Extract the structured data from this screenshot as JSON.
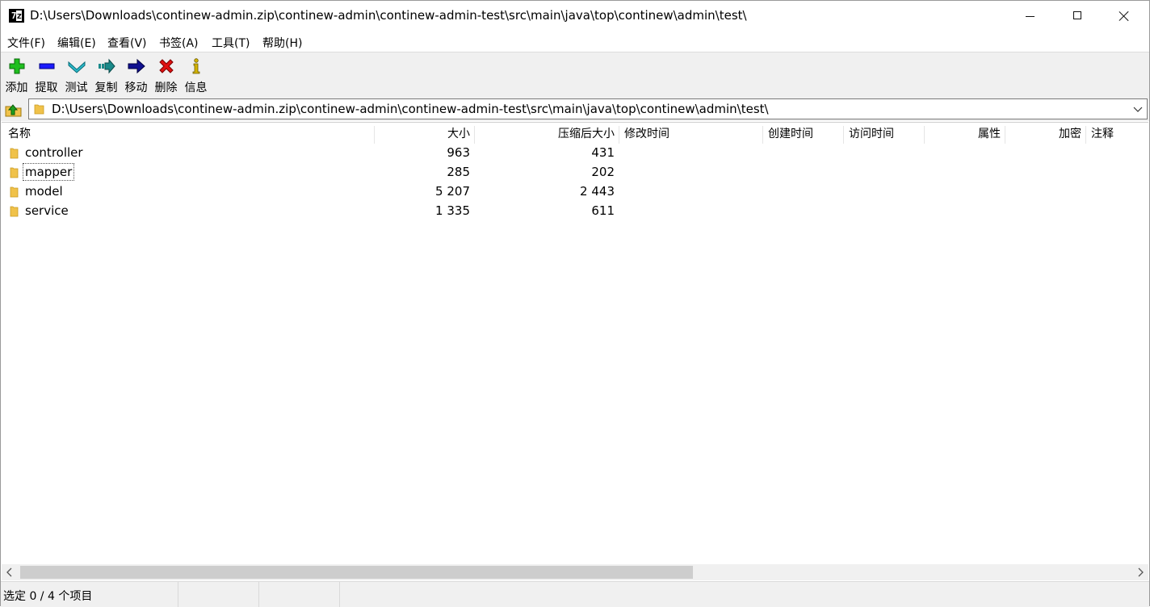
{
  "window": {
    "title": "D:\\Users\\Downloads\\continew-admin.zip\\continew-admin\\continew-admin-test\\src\\main\\java\\top\\continew\\admin\\test\\",
    "icon": "7z-app-icon",
    "icon_text_left": "7",
    "icon_text_right": "z"
  },
  "menu": [
    {
      "label": "文件(F)"
    },
    {
      "label": "编辑(E)"
    },
    {
      "label": "查看(V)"
    },
    {
      "label": "书签(A)"
    },
    {
      "label": "工具(T)"
    },
    {
      "label": "帮助(H)"
    }
  ],
  "toolbar": [
    {
      "label": "添加",
      "icon": "add-icon",
      "color": "#1fbf1f"
    },
    {
      "label": "提取",
      "icon": "extract-icon",
      "color": "#1a1aff"
    },
    {
      "label": "测试",
      "icon": "test-icon",
      "color": "#2ab8c8"
    },
    {
      "label": "复制",
      "icon": "copy-icon",
      "color": "#1a8a8a"
    },
    {
      "label": "移动",
      "icon": "move-icon",
      "color": "#101090"
    },
    {
      "label": "删除",
      "icon": "delete-icon",
      "color": "#e01010"
    },
    {
      "label": "信息",
      "icon": "info-icon",
      "color": "#d4b400"
    }
  ],
  "address": {
    "path": "D:\\Users\\Downloads\\continew-admin.zip\\continew-admin\\continew-admin-test\\src\\main\\java\\top\\continew\\admin\\test\\"
  },
  "columns": {
    "name": "名称",
    "size": "大小",
    "packed": "压缩后大小",
    "modified": "修改时间",
    "created": "创建时间",
    "accessed": "访问时间",
    "attributes": "属性",
    "encrypted": "加密",
    "comment": "注释"
  },
  "files": [
    {
      "name": "controller",
      "size": "963",
      "packed": "431"
    },
    {
      "name": "mapper",
      "size": "285",
      "packed": "202"
    },
    {
      "name": "model",
      "size": "5 207",
      "packed": "2 443"
    },
    {
      "name": "service",
      "size": "1 335",
      "packed": "611"
    }
  ],
  "status": {
    "selection": "选定 0 / 4 个项目"
  },
  "colors": {
    "folder": "#f0c24a",
    "chrome": "#f0f0f0"
  }
}
